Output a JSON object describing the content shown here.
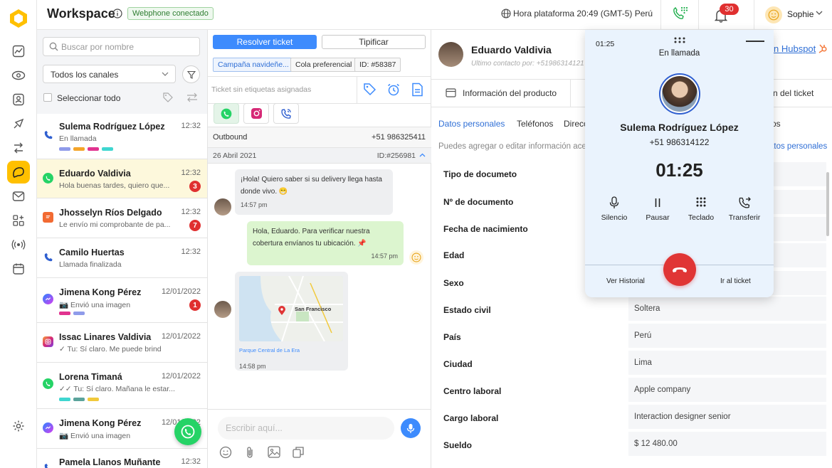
{
  "header": {
    "title": "Workspace",
    "webphone_status": "Webphone conectado",
    "platform_time": "Hora plataforma 20:49 (GMT-5) Perú",
    "notification_count": "30",
    "user_name": "Sophie"
  },
  "list": {
    "search_placeholder": "Buscar por nombre",
    "channel_filter": "Todos los canales",
    "select_all": "Seleccionar todo",
    "conversations": [
      {
        "name": "Sulema Rodríguez López",
        "time": "12:32",
        "preview": "En llamada",
        "channel": "phone"
      },
      {
        "name": "Eduardo Valdivia",
        "time": "12:32",
        "preview": "Hola buenas tardes, quiero que...",
        "channel": "whatsapp",
        "badge": "3"
      },
      {
        "name": "Jhosselyn Ríos Delgado",
        "time": "12:32",
        "preview": "Le envío mi comprobante de pa...",
        "channel": "chat",
        "badge": "7"
      },
      {
        "name": "Camilo Huertas",
        "time": "12:32",
        "preview": "Llamada finalizada",
        "channel": "phone"
      },
      {
        "name": "Jimena Kong Pérez",
        "time": "12/01/2022",
        "preview": "📷 Envió una imagen",
        "channel": "messenger",
        "badge": "1"
      },
      {
        "name": "Issac Linares Valdivia",
        "time": "12/01/2022",
        "preview": "✓ Tu: Sí claro. Me puede brind",
        "channel": "instagram"
      },
      {
        "name": "Lorena Timaná",
        "time": "12/01/2022",
        "preview": "✓✓ Tu: Sí claro. Mañana le estar...",
        "channel": "whatsapp"
      },
      {
        "name": "Jimena Kong Pérez",
        "time": "12/01/2022",
        "preview": "📷 Envió una imagen",
        "channel": "messenger"
      },
      {
        "name": "Pamela Llanos Muñante",
        "time": "12:32",
        "preview": "",
        "channel": "phone"
      }
    ]
  },
  "chat": {
    "resolve_button": "Resolver ticket",
    "tipificar_button": "Tipificar",
    "chips": [
      "Campaña navideñe...",
      "Cola preferencial",
      "ID: #58387"
    ],
    "tags_placeholder": "Ticket sin etiquetas asignadas",
    "direction": "Outbound",
    "phone": "+51 986325411",
    "date": "26 Abril 2021",
    "message_id": "ID:#256981",
    "messages": [
      {
        "text": "¡Hola! Quiero saber si su delivery llega hasta donde vivo. 😁",
        "time": "14:57 pm"
      },
      {
        "text": "Hola, Eduardo. Para verificar nuestra cobertura envíanos tu ubicación. 📌",
        "time": "14:57 pm"
      },
      {
        "map_city": "San Francisco",
        "map_link": "Parque Central de La Era",
        "time": "14:58 pm"
      }
    ],
    "input_placeholder": "Escribir aquí..."
  },
  "detail": {
    "contact_name": "Eduardo Valdivia",
    "last_contact": "Último contacto por: +51986314121",
    "hubspot_link": "n Hubspot",
    "tabs": [
      "Información del producto",
      "n del ticket"
    ],
    "subtabs": [
      "Datos personales",
      "Teléfonos",
      "Direcc",
      "os"
    ],
    "hint": "Puedes agregar o editar información acerc",
    "edit_link": "atos personales",
    "fields": [
      {
        "label": "Tipo de documeto",
        "value": ""
      },
      {
        "label": "Nº de documento",
        "value": ""
      },
      {
        "label": "Fecha de nacimiento",
        "value": ""
      },
      {
        "label": "Edad",
        "value": ""
      },
      {
        "label": "Sexo",
        "value": ""
      },
      {
        "label": "Estado civil",
        "value": "Soltera"
      },
      {
        "label": "País",
        "value": "Perú"
      },
      {
        "label": "Ciudad",
        "value": "Lima"
      },
      {
        "label": "Centro laboral",
        "value": "Apple company"
      },
      {
        "label": "Cargo laboral",
        "value": "Interaction designer senior"
      },
      {
        "label": "Sueldo",
        "value": "$ 12 480.00"
      }
    ]
  },
  "call": {
    "mini_timer": "01:25",
    "status": "En llamada",
    "caller_name": "Sulema Rodríguez López",
    "caller_phone": "+51 986314122",
    "timer": "01:25",
    "controls": [
      "Silencio",
      "Pausar",
      "Teclado",
      "Transferir"
    ],
    "history_link": "Ver Historial",
    "ticket_link": "Ir al ticket"
  },
  "colors": {
    "accent_yellow": "#ffc000",
    "primary_blue": "#3d8bfd",
    "hangup_red": "#e03535",
    "whatsapp_green": "#25d366",
    "badge_red": "#e03030"
  }
}
